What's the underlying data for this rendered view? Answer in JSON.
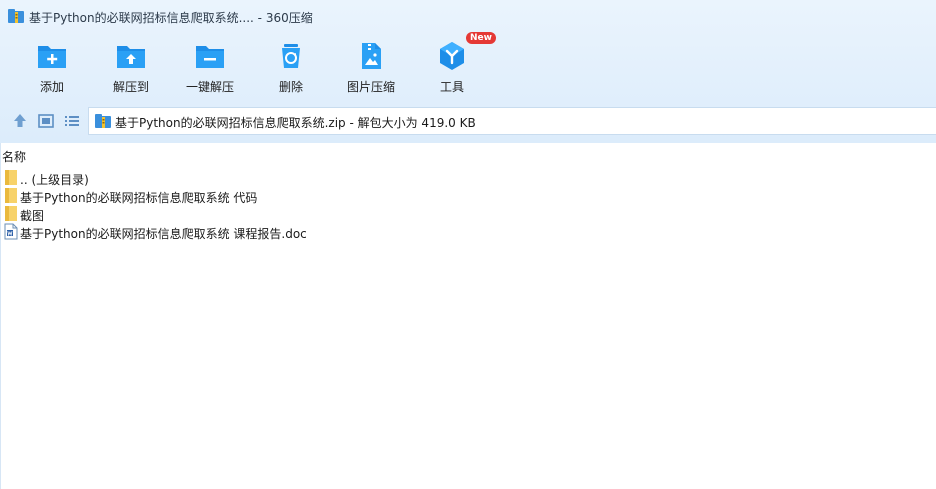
{
  "window": {
    "title": "基于Python的必联网招标信息爬取系统.... - 360压缩"
  },
  "toolbar": {
    "items": [
      {
        "label": "添加",
        "icon": "folder-add-icon"
      },
      {
        "label": "解压到",
        "icon": "folder-extract-icon"
      },
      {
        "label": "一键解压",
        "icon": "folder-one-click-extract-icon"
      },
      {
        "label": "删除",
        "icon": "recycle-bin-icon"
      },
      {
        "label": "图片压缩",
        "icon": "image-compress-icon"
      },
      {
        "label": "工具",
        "icon": "tools-icon",
        "badge": "New"
      }
    ]
  },
  "navbar": {
    "buttons": [
      "up-arrow-icon",
      "view-thumbnail-icon",
      "view-list-icon"
    ],
    "address": "基于Python的必联网招标信息爬取系统.zip - 解包大小为 419.0 KB"
  },
  "list": {
    "header_name": "名称",
    "rows": [
      {
        "name": ".. (上级目录)",
        "icon": "folder-icon"
      },
      {
        "name": "基于Python的必联网招标信息爬取系统 代码",
        "icon": "folder-icon"
      },
      {
        "name": "截图",
        "icon": "folder-icon"
      },
      {
        "name": "基于Python的必联网招标信息爬取系统 课程报告.doc",
        "icon": "word-document-icon"
      }
    ]
  },
  "colors": {
    "accent": "#1e8ee8",
    "toolbar_bg": "#e3effb",
    "badge": "#e53935"
  }
}
